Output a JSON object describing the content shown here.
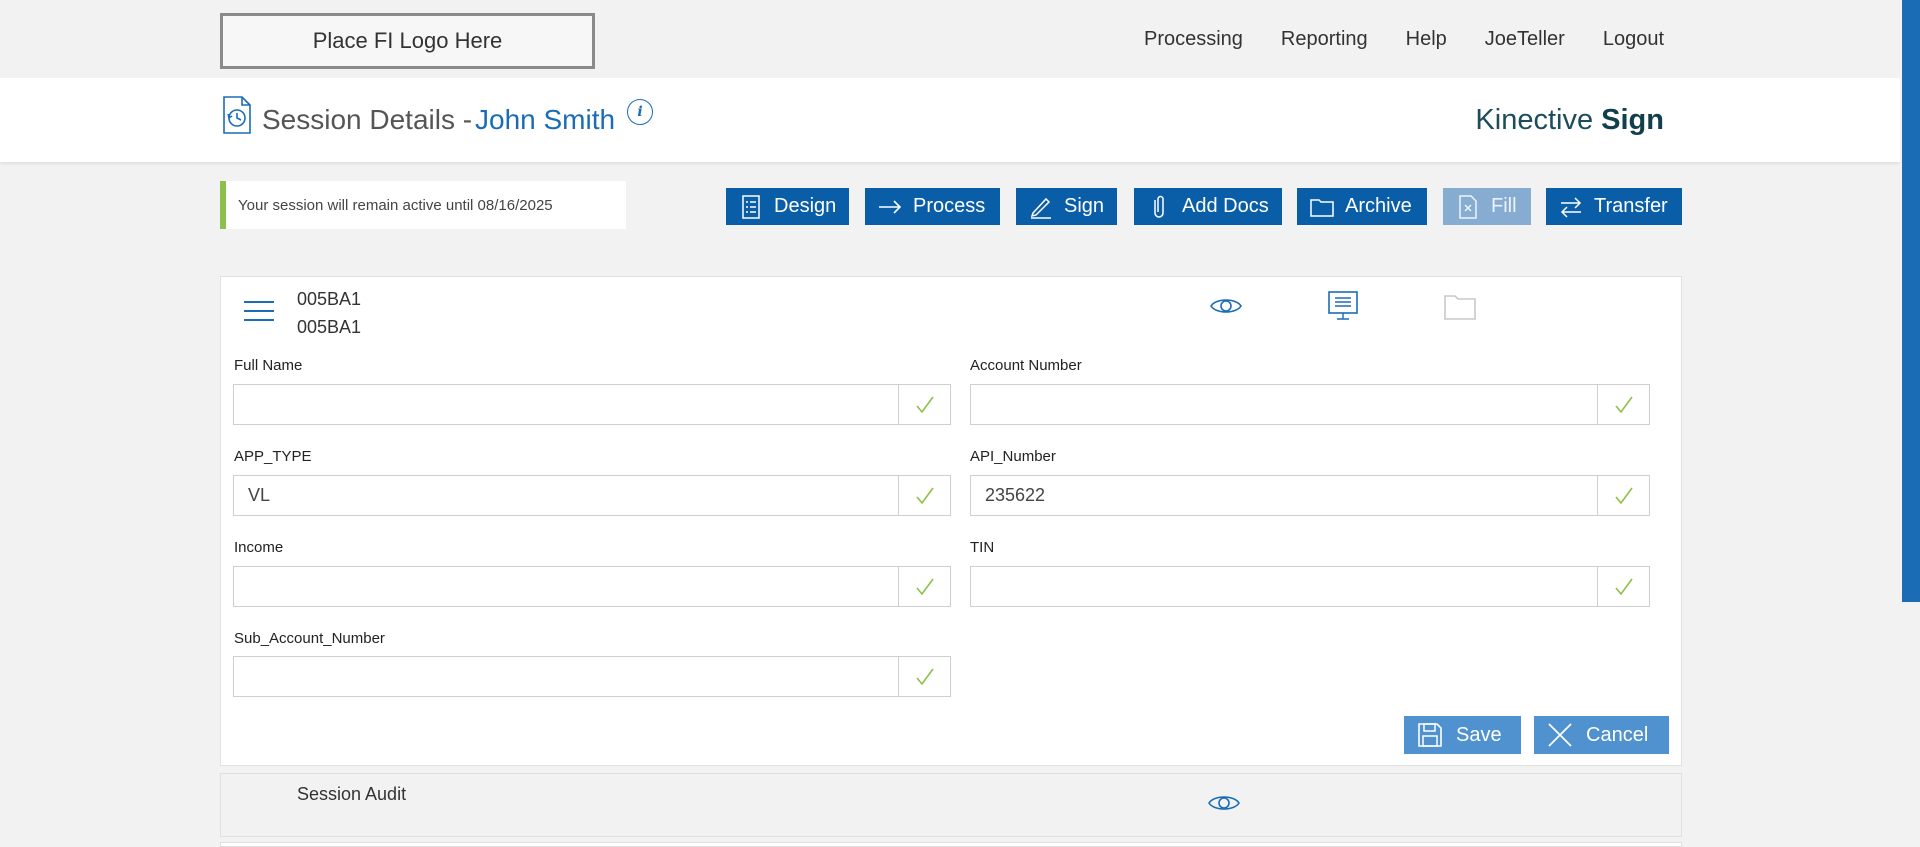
{
  "topbar": {
    "logo_text": "Place FI Logo Here",
    "nav": [
      "Processing",
      "Reporting",
      "Help",
      "JoeTeller",
      "Logout"
    ]
  },
  "header": {
    "title": "Session Details -",
    "customer_name": "John Smith",
    "info_glyph": "i",
    "brand_light": "Kinective ",
    "brand_bold": "Sign"
  },
  "session_note": "Your session will remain active until 08/16/2025",
  "toolbar": {
    "design": "Design",
    "process": "Process",
    "sign": "Sign",
    "add_docs": "Add Docs",
    "archive": "Archive",
    "fill": "Fill",
    "transfer": "Transfer"
  },
  "document": {
    "ids": [
      "005BA1",
      "005BA1"
    ],
    "fields": [
      {
        "label": "Full Name",
        "value": ""
      },
      {
        "label": "Account Number",
        "value": ""
      },
      {
        "label": "APP_TYPE",
        "value": "VL"
      },
      {
        "label": "API_Number",
        "value": "235622"
      },
      {
        "label": "Income",
        "value": ""
      },
      {
        "label": "TIN",
        "value": ""
      },
      {
        "label": "Sub_Account_Number",
        "value": ""
      }
    ],
    "save": "Save",
    "cancel": "Cancel"
  },
  "audit": {
    "title": "Session Audit"
  },
  "colors": {
    "primary": "#0a5ea8",
    "accent_link": "#1a6db5",
    "disabled": "#86acd2",
    "action": "#4f92cf",
    "check": "#8cc04a"
  },
  "icons": {
    "session": "session-history-icon",
    "info": "info-icon",
    "menu": "hamburger-menu-icon",
    "view": "eye-icon",
    "monitor": "monitor-icon",
    "folder": "folder-icon",
    "check": "checkmark-icon"
  }
}
